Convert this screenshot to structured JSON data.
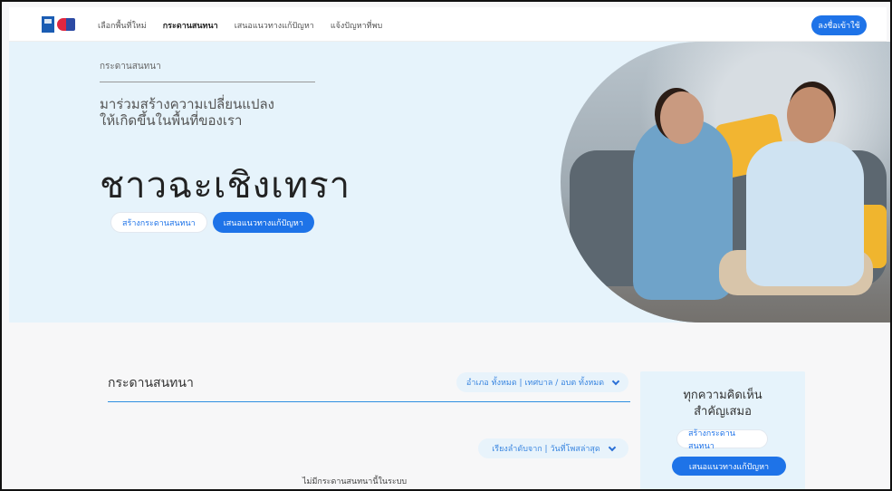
{
  "nav": {
    "links": [
      "เลือกพื้นที่ใหม่",
      "กระดานสนทนา",
      "เสนอแนวทางแก้ปัญหา",
      "แจ้งปัญหาที่พบ"
    ],
    "login_label": "ลงชื่อเข้าใช้"
  },
  "hero": {
    "eyebrow": "กระดานสนทนา",
    "subtitle_line1": "มาร่วมสร้างความเปลี่ยนแปลง",
    "subtitle_line2": "ให้เกิดขึ้นในพื้นที่ของเรา",
    "title": "ชาวฉะเชิงเทรา",
    "btn_create": "สร้างกระดานสนทนา",
    "btn_propose": "เสนอแนวทางแก้ปัญหา"
  },
  "board": {
    "title": "กระดานสนทนา",
    "filter_area": "อำเภอ ทั้งหมด | เทศบาล / อบต ทั้งหมด",
    "sort": "เรียงลำดับจาก | วันที่โพสล่าสุด",
    "empty": "ไม่มีกระดานสนทนานี้ในระบบ"
  },
  "side": {
    "title_line1": "ทุกความคิดเห็น",
    "title_line2": "สำคัญเสมอ",
    "btn_create": "สร้างกระดานสนทนา",
    "btn_propose": "เสนอแนวทางแก้ปัญหา"
  },
  "colors": {
    "accent": "#1e73e8",
    "hero_bg": "#e6f3fb"
  }
}
